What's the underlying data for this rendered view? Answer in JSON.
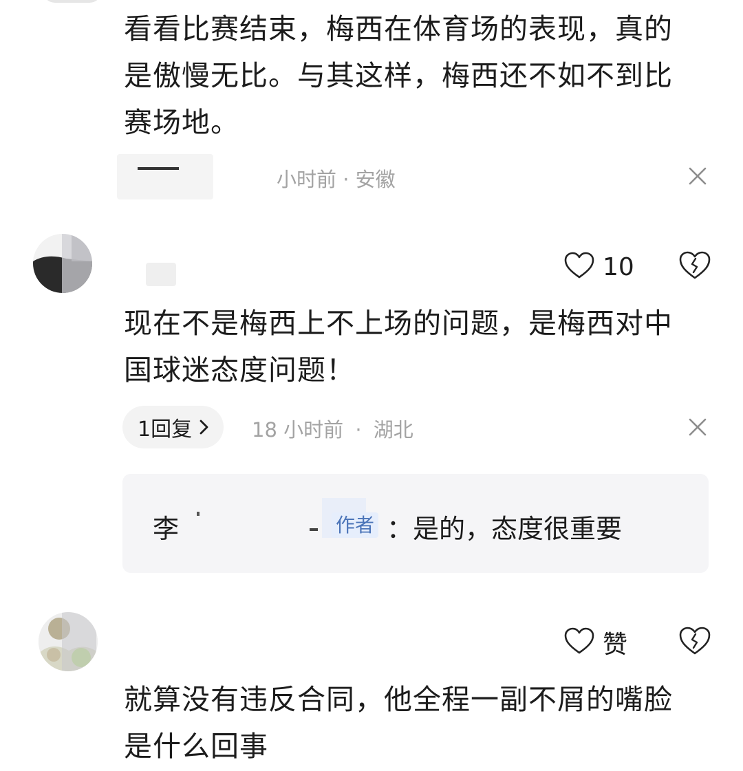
{
  "comments": [
    {
      "text_lines": [
        "看看比赛结束，梅西在体育场的表现，真的",
        "是傲慢无比。与其这样，梅西还不如不到比",
        "赛场地。"
      ],
      "meta_partial": "小时前 · 安徽",
      "close_label": "×"
    },
    {
      "like_count": "10",
      "text_lines": [
        "现在不是梅西上不上场的问题，是梅西对中",
        "国球迷态度问题！"
      ],
      "reply_count_label": "1回复",
      "reply_chevron": "›",
      "time": "18 小时前",
      "location": "湖北",
      "separator": "·",
      "reply": {
        "author_initial": "李",
        "author_tag": "作者",
        "text": "：是的，态度很重要"
      }
    },
    {
      "like_label": "赞",
      "text_lines": [
        "就算没有违反合同，他全程一副不屑的嘴脸",
        "是什么回事"
      ]
    }
  ],
  "icons": {
    "like": "heart-outline-icon",
    "dislike": "broken-heart-icon",
    "close": "close-icon",
    "chevron": "chevron-right-icon"
  },
  "colors": {
    "meta_gray": "#a3a3a3",
    "text": "#1c1c1c",
    "reply_bg": "#f5f5f7",
    "author_tag": "#4b74b8"
  }
}
